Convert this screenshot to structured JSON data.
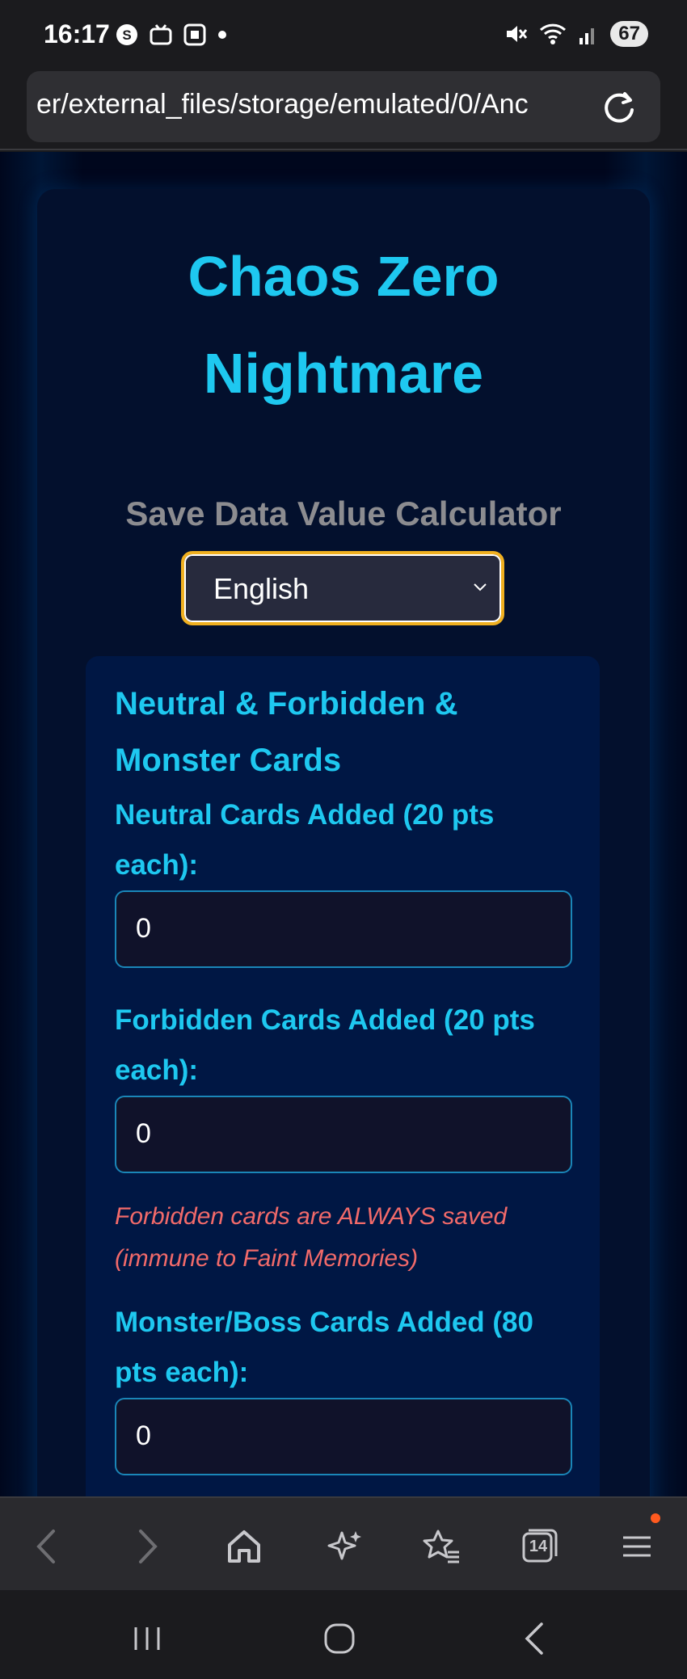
{
  "status_bar": {
    "time": "16:17",
    "battery": "67"
  },
  "browser": {
    "url": "er/external_files/storage/emulated/0/Anc",
    "tabs_count": "14"
  },
  "page": {
    "title_line1": "Chaos Zero",
    "title_line2": "Nightmare",
    "subtitle": "Save Data Value Calculator",
    "language": "English",
    "card_heading": "Neutral & Forbidden & Monster Cards",
    "fields": [
      {
        "label": "Neutral Cards Added (20 pts each):",
        "value": "0"
      },
      {
        "label": "Forbidden Cards Added (20 pts each):",
        "value": "0"
      },
      {
        "label": "Monster/Boss Cards Added (80 pts each):",
        "value": "0"
      }
    ],
    "forbidden_note": "Forbidden cards are ALWAYS saved (immune to Faint Memories)"
  },
  "colors": {
    "accent": "#1ec8f0",
    "warning": "#f26a6a",
    "select_border": "#f0b020",
    "notification_dot": "#ff5a1f"
  }
}
